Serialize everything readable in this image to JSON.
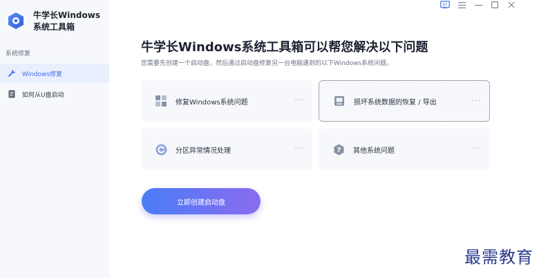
{
  "app": {
    "title": "牛学长Windows系统工具箱"
  },
  "sidebar": {
    "section_label": "系统修复",
    "items": [
      {
        "label": "Windows修复",
        "icon": "wrench-icon",
        "active": true
      },
      {
        "label": "如何从U盘启动",
        "icon": "document-icon",
        "active": false
      }
    ]
  },
  "window_controls": [
    "feedback-icon",
    "menu-icon",
    "minimize-icon",
    "maximize-icon",
    "close-icon"
  ],
  "main": {
    "heading": "牛学长Windows系统工具箱可以帮您解决以下问题",
    "subheading": "您需要先创建一个启动盘，然后通过启动盘修复另一台电脑遇到的以下Windows系统问题。",
    "cards": [
      {
        "label": "修复Windows系统问题",
        "icon": "windows-grid-icon",
        "more": "···"
      },
      {
        "label": "损坏系统数据的恢复 / 导出",
        "icon": "drive-icon",
        "more": "···"
      },
      {
        "label": "分区异常情况处理",
        "icon": "partition-icon",
        "more": "···"
      },
      {
        "label": "其他系统问题",
        "icon": "question-icon",
        "more": "···"
      }
    ],
    "cta_label": "立即创建启动盘"
  },
  "watermark": "最需教育",
  "colors": {
    "accent": "#3f6ff0",
    "cta_start": "#4b7cf5",
    "cta_end": "#8a6cf0",
    "sidebar_bg": "#f6f8fb",
    "card_bg": "#f7f8fb"
  }
}
